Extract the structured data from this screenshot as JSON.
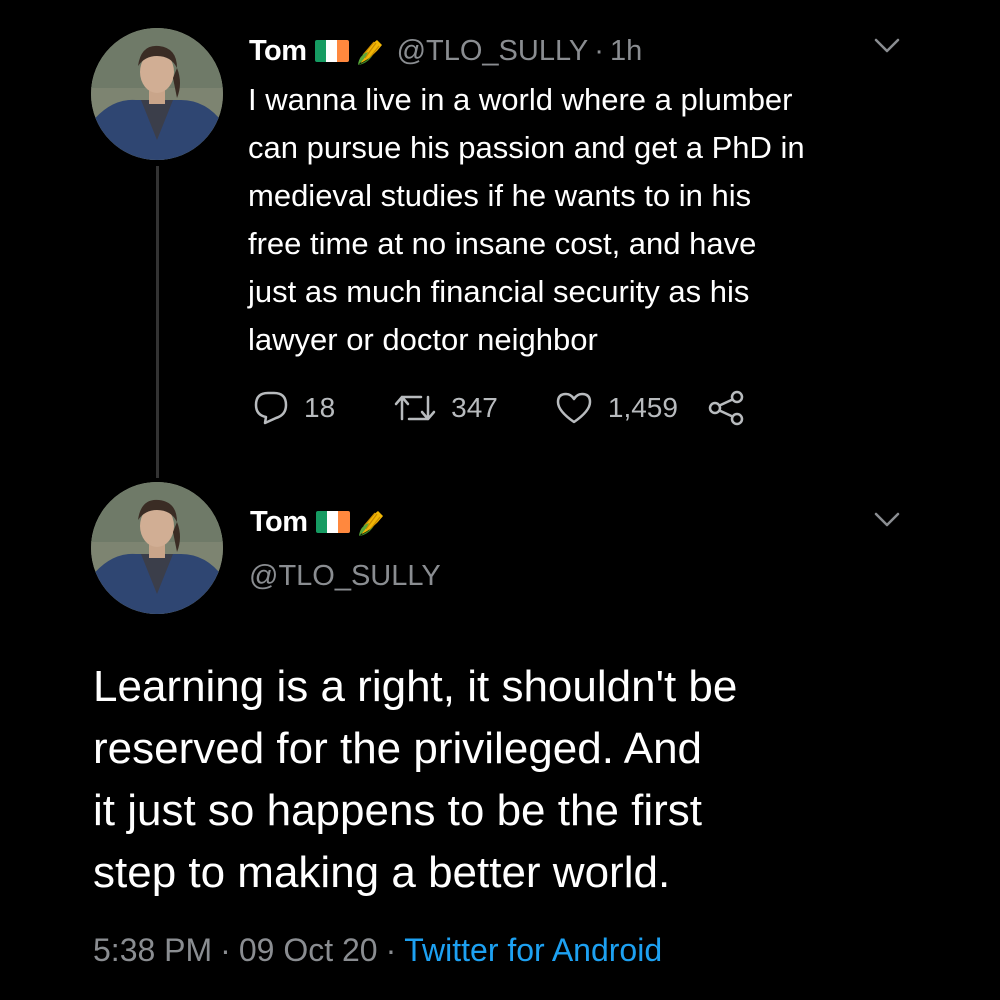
{
  "colors": {
    "background": "#000000",
    "text": "#ffffff",
    "muted": "#8a8d91",
    "link": "#1da1f2",
    "flag_green": "#169b62",
    "flag_white": "#ffffff",
    "flag_orange": "#ff883e"
  },
  "reply_tweet": {
    "author_name": "Tom",
    "handle": "@TLO_SULLY",
    "separator": "·",
    "time_ago": "1h",
    "text": "I wanna live in a world where a plumber\ncan pursue his passion and get a PhD in\nmedieval studies if he wants to in his\nfree time at no insane cost, and have\njust as much financial security as his\nlawyer or doctor neighbor",
    "reply_count": "18",
    "retweet_count": "347",
    "like_count": "1,459",
    "icons": [
      "avatar",
      "ireland-flag-icon",
      "corn-icon",
      "chevron-down-icon",
      "reply-icon",
      "retweet-icon",
      "like-icon",
      "share-icon"
    ]
  },
  "main_tweet": {
    "author_name": "Tom",
    "handle": "@TLO_SULLY",
    "text": "Learning is a right, it shouldn't be\nreserved for the privileged. And\nit just so happens to be the first\nstep to making a better world.",
    "time": "5:38 PM",
    "date": "09 Oct 20",
    "separator": "·",
    "source": "Twitter for Android",
    "icons": [
      "avatar",
      "ireland-flag-icon",
      "corn-icon",
      "chevron-down-icon"
    ]
  }
}
